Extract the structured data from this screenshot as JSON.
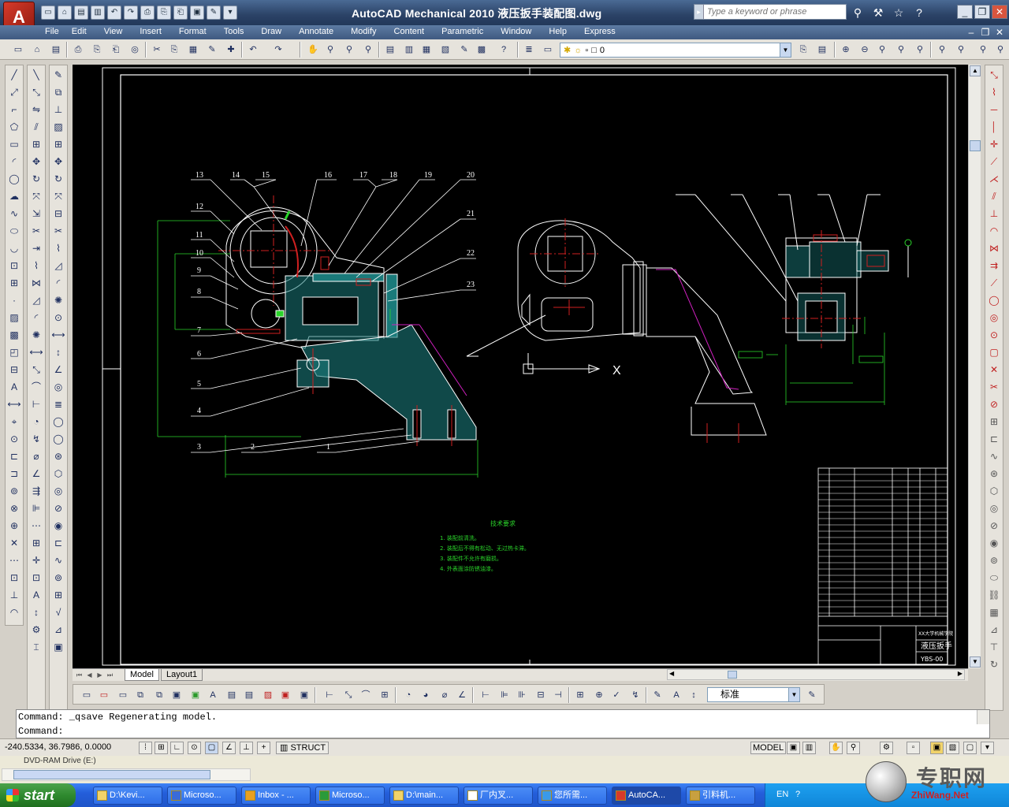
{
  "window": {
    "title": "AutoCAD Mechanical 2010    液压扳手装配图.dwg",
    "app_logo_letter": "A",
    "app_logo_badge": "M",
    "search_placeholder": "Type a keyword or phrase"
  },
  "menu": [
    "File",
    "Edit",
    "View",
    "Insert",
    "Format",
    "Tools",
    "Draw",
    "Annotate",
    "Modify",
    "Content",
    "Parametric",
    "Window",
    "Help",
    "Express"
  ],
  "layer": {
    "current": "0"
  },
  "tabs": {
    "model": "Model",
    "layout": "Layout1"
  },
  "drawing": {
    "part_numbers": [
      "13",
      "14",
      "15",
      "16",
      "17",
      "18",
      "19",
      "20",
      "21",
      "22",
      "23",
      "12",
      "11",
      "10",
      "9",
      "8",
      "7",
      "6",
      "5",
      "4",
      "3",
      "2",
      "1"
    ],
    "tech_req_title": "技术要求",
    "tech_req": [
      "1. 装配前清洗。",
      "2. 装配后不得有松动、无过热卡滞。",
      "3. 装配件不允许有磨损。",
      "4. 外表面涂防锈油漆。"
    ],
    "title_block": {
      "name": "液压扳手",
      "drawing_no": "YBS-00",
      "company": "XX大学机械学院"
    },
    "axis_x_label": "X"
  },
  "toolbar2": {
    "style_value": "标准"
  },
  "command": {
    "history": "Command: _qsave Regenerating model.",
    "prompt": "Command:"
  },
  "status": {
    "coords": "-240.5334, 36.7986, 0.0000",
    "struct_label": "STRUCT",
    "model_label": "MODEL"
  },
  "explorer": {
    "dvd_label": "DVD-RAM Drive (E:)"
  },
  "taskbar": {
    "start_label": "start",
    "tasks": [
      "D:\\Kevi...",
      "Microso...",
      "Inbox - ...",
      "Microso...",
      "D:\\main...",
      "厂内叉...",
      "您所需...",
      "AutoCA...",
      "引料机..."
    ],
    "lang": "EN"
  },
  "watermark": {
    "text": "专职网",
    "url": "ZhiWang.Net"
  }
}
